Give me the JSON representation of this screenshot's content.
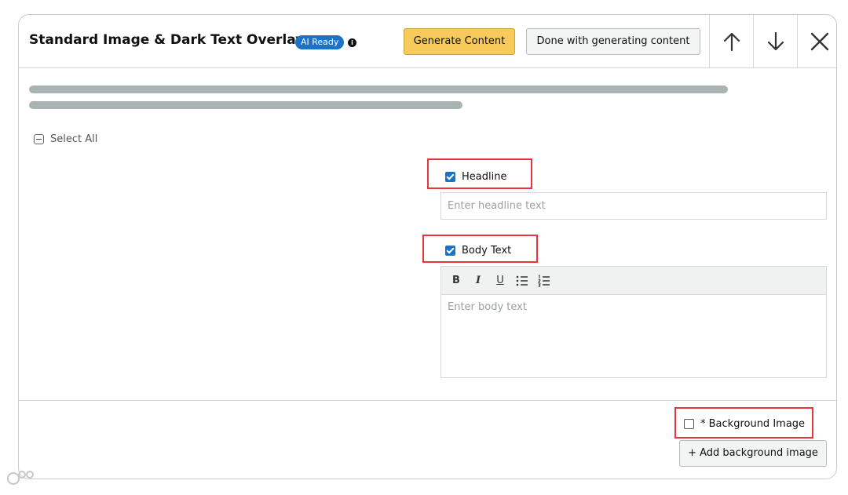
{
  "header": {
    "title": "Standard Image & Dark Text Overlay",
    "ai_badge": "AI Ready",
    "info_glyph": "i",
    "generate_label": "Generate Content",
    "done_label": "Done with generating content",
    "icons": [
      "arrow-up-icon",
      "arrow-down-icon",
      "close-icon"
    ]
  },
  "select_all_label": "Select All",
  "headline": {
    "label": "Headline",
    "checked": true,
    "placeholder": "Enter headline text",
    "value": ""
  },
  "body_text": {
    "label": "Body Text",
    "checked": true,
    "placeholder": "Enter body text",
    "toolbar": {
      "bold": "B",
      "italic": "I",
      "underline": "U"
    }
  },
  "background_image": {
    "label": "* Background Image",
    "checked": false,
    "add_button_label": "+ Add background image"
  },
  "colors": {
    "accent": "#1a73c8",
    "generate_button": "#f7ca5b",
    "highlight_box": "#e8353a"
  }
}
